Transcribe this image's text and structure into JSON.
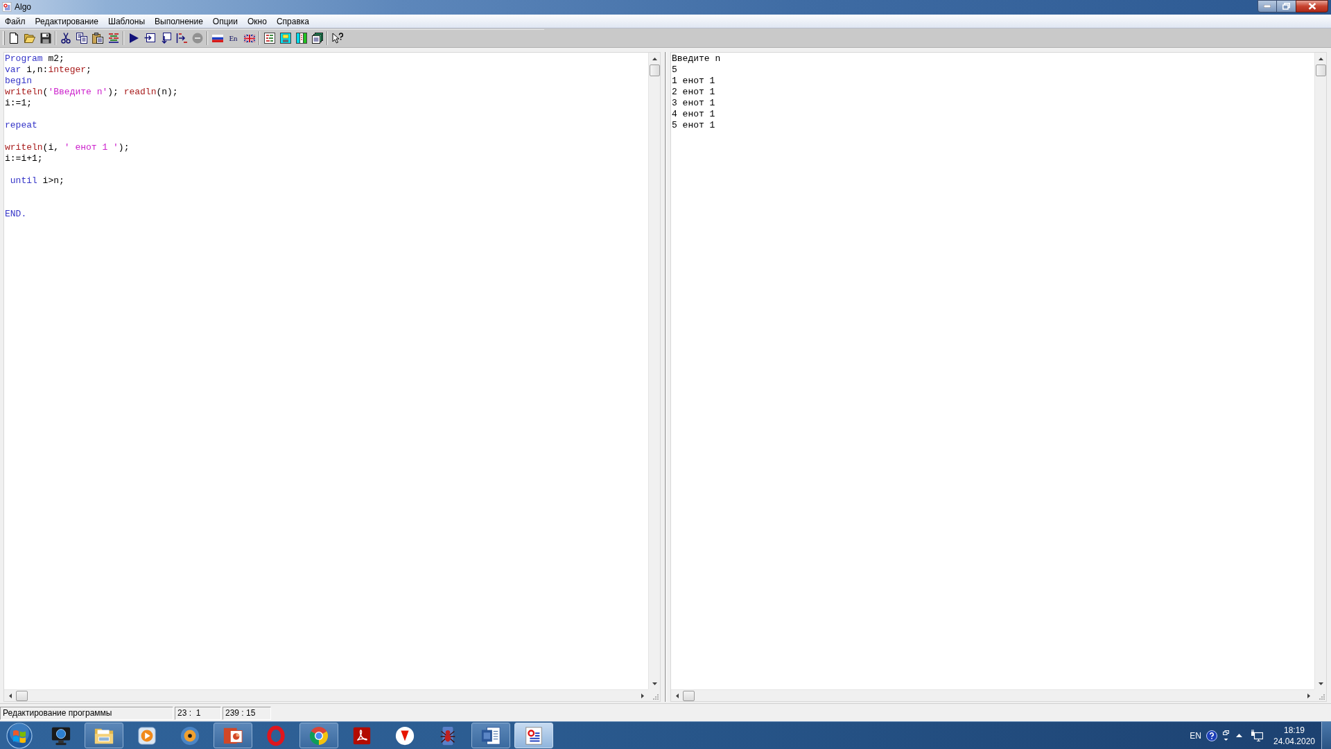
{
  "window": {
    "title": "Algo"
  },
  "menu": [
    "Файл",
    "Редактирование",
    "Шаблоны",
    "Выполнение",
    "Опции",
    "Окно",
    "Справка"
  ],
  "toolbar": {
    "groups": [
      [
        {
          "kind": "icon",
          "disabled": false
        },
        {
          "kind": "icon",
          "disabled": false
        },
        {
          "kind": "icon",
          "disabled": false
        }
      ],
      [
        {
          "kind": "icon",
          "disabled": false
        },
        {
          "kind": "icon",
          "disabled": false
        },
        {
          "kind": "icon",
          "disabled": false
        },
        {
          "kind": "icon",
          "disabled": false
        }
      ],
      [
        {
          "kind": "icon",
          "disabled": false
        },
        {
          "kind": "icon",
          "disabled": false
        },
        {
          "kind": "icon",
          "disabled": false
        },
        {
          "kind": "icon",
          "disabled": false
        },
        {
          "kind": "icon",
          "disabled": true
        }
      ],
      [
        {
          "kind": "icon",
          "disabled": false
        },
        {
          "kind": "text",
          "label": "En",
          "disabled": false
        },
        {
          "kind": "icon",
          "disabled": false
        }
      ],
      [
        {
          "kind": "icon",
          "disabled": false
        },
        {
          "kind": "icon",
          "disabled": false
        },
        {
          "kind": "icon",
          "disabled": false
        },
        {
          "kind": "icon",
          "disabled": false
        }
      ],
      [
        {
          "kind": "icon",
          "disabled": false
        }
      ]
    ]
  },
  "editor": {
    "lines": [
      {
        "kind": "code",
        "tokens": [
          {
            "kind": "keyword",
            "text": "Program"
          },
          {
            "kind": "plain",
            "text": " m2;"
          }
        ]
      },
      {
        "kind": "code",
        "tokens": [
          {
            "kind": "keyword",
            "text": "var"
          },
          {
            "kind": "plain",
            "text": " i,n:"
          },
          {
            "kind": "builtin",
            "text": "integer"
          },
          {
            "kind": "plain",
            "text": ";"
          }
        ]
      },
      {
        "kind": "code",
        "tokens": [
          {
            "kind": "keyword",
            "text": "begin"
          }
        ]
      },
      {
        "kind": "code",
        "tokens": [
          {
            "kind": "builtin",
            "text": "writeln"
          },
          {
            "kind": "plain",
            "text": "("
          },
          {
            "kind": "string",
            "text": "'Введите n'"
          },
          {
            "kind": "plain",
            "text": "); "
          },
          {
            "kind": "builtin",
            "text": "readln"
          },
          {
            "kind": "plain",
            "text": "(n);"
          }
        ]
      },
      {
        "kind": "code",
        "tokens": [
          {
            "kind": "plain",
            "text": "i:=1;"
          }
        ]
      },
      {
        "kind": "blank"
      },
      {
        "kind": "code",
        "tokens": [
          {
            "kind": "keyword",
            "text": "repeat"
          }
        ]
      },
      {
        "kind": "blank"
      },
      {
        "kind": "code",
        "tokens": [
          {
            "kind": "builtin",
            "text": "writeln"
          },
          {
            "kind": "plain",
            "text": "(i, "
          },
          {
            "kind": "string",
            "text": "' енот 1 '"
          },
          {
            "kind": "plain",
            "text": ");"
          }
        ]
      },
      {
        "kind": "code",
        "tokens": [
          {
            "kind": "plain",
            "text": "i:=i+1;"
          }
        ]
      },
      {
        "kind": "blank"
      },
      {
        "kind": "code",
        "tokens": [
          {
            "kind": "keyword",
            "text": " until"
          },
          {
            "kind": "plain",
            "text": " i>n;"
          }
        ]
      },
      {
        "kind": "blank"
      },
      {
        "kind": "blank"
      },
      {
        "kind": "code",
        "tokens": [
          {
            "kind": "keyword",
            "text": "END."
          }
        ]
      }
    ]
  },
  "output": {
    "lines": [
      "Введите n",
      "5",
      "1 енот 1",
      "2 енот 1",
      "3 енот 1",
      "4 енот 1",
      "5 енот 1"
    ]
  },
  "status_bar": {
    "panels": [
      "Редактирование программы",
      "23 :  1",
      "239 : 15"
    ]
  },
  "taskbar": {
    "apps": [
      {
        "running": false,
        "selected": false
      },
      {
        "running": true,
        "selected": false
      },
      {
        "running": false,
        "selected": false
      },
      {
        "running": false,
        "selected": false
      },
      {
        "running": true,
        "selected": false
      },
      {
        "running": false,
        "selected": false
      },
      {
        "running": true,
        "selected": false
      },
      {
        "running": false,
        "selected": false
      },
      {
        "running": false,
        "selected": false
      },
      {
        "running": false,
        "selected": false
      },
      {
        "running": true,
        "selected": false
      },
      {
        "running": true,
        "selected": true
      }
    ],
    "tray": {
      "language": "EN"
    },
    "clock": {
      "time": "18:19",
      "date": "24.04.2020"
    }
  }
}
